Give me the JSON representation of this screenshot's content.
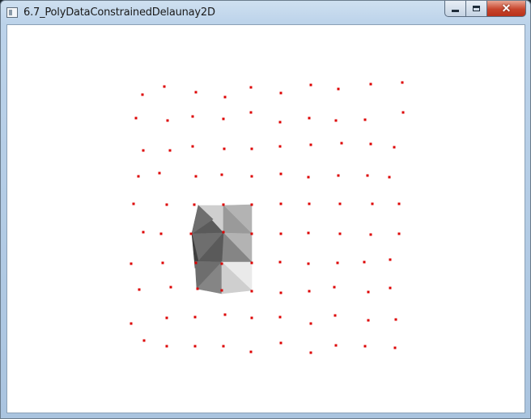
{
  "window": {
    "title": "6.7_PolyDataConstrainedDelaunay2D",
    "icon": "window-app-icon",
    "controls": {
      "minimize_icon": "minimize-icon",
      "maximize_icon": "maximize-icon",
      "close_icon": "close-icon"
    }
  },
  "viewport": {
    "background_color": "#ffffff",
    "point_color": "#dd0000",
    "mesh_shades": [
      "#3f3f3f",
      "#5a5a5a",
      "#6e6e6e",
      "#858585",
      "#9a9a9a",
      "#b3b3b3",
      "#cfcfcf",
      "#eaeaea"
    ]
  }
}
